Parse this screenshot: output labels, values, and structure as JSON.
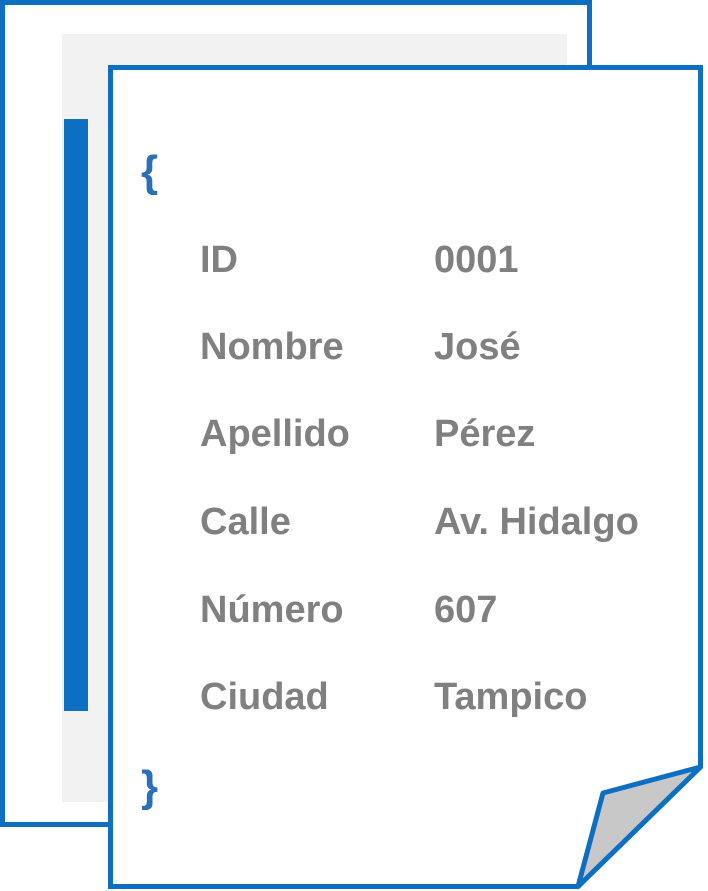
{
  "colors": {
    "accent": "#0c6fc2",
    "text": "#808080",
    "panel": "#f2f2f2",
    "fold": "#c8c8c8"
  },
  "braces": {
    "open": "{",
    "close": "}"
  },
  "record": [
    {
      "key": "ID",
      "value": "0001"
    },
    {
      "key": "Nombre",
      "value": "José"
    },
    {
      "key": "Apellido",
      "value": "Pérez"
    },
    {
      "key": "Calle",
      "value": "Av. Hidalgo"
    },
    {
      "key": "Número",
      "value": "607"
    },
    {
      "key": "Ciudad",
      "value": "Tampico"
    }
  ]
}
